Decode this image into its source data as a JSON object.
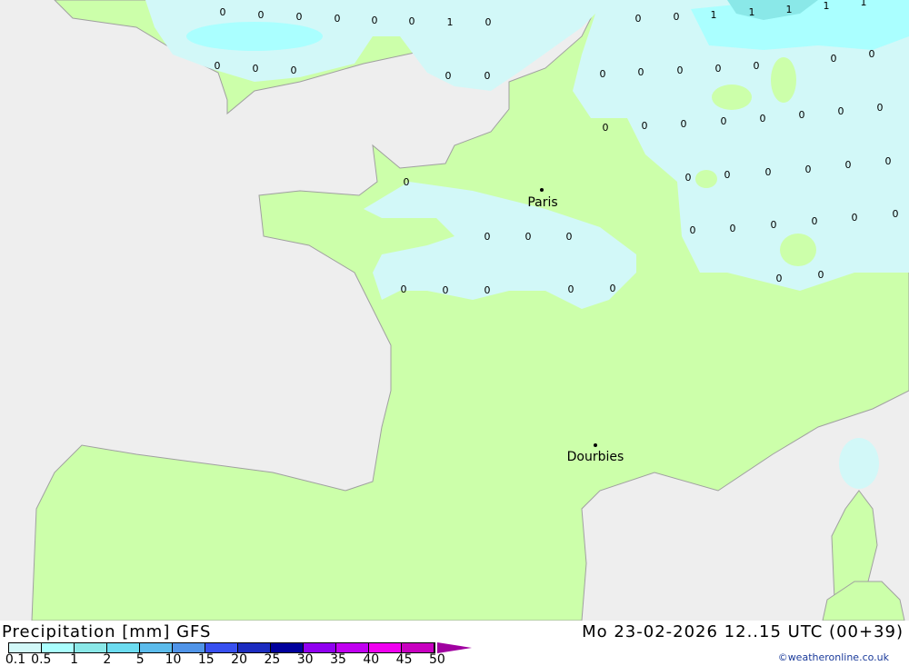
{
  "map": {
    "colors": {
      "sea": "#eeeeee",
      "land": "#ccffaa",
      "p01": "#d2f8f8",
      "p05": "#aaffff",
      "p1": "#8ae8e8",
      "border": "#a0a0a0"
    },
    "cities": [
      {
        "name": "Paris"
      },
      {
        "name": "Dourbies"
      }
    ],
    "values": [
      "0",
      "0",
      "0",
      "0",
      "0",
      "0",
      "1",
      "0",
      "0",
      "0",
      "0",
      "0",
      "0",
      "0",
      "0",
      "1",
      "1",
      "1",
      "1",
      "1",
      "0",
      "0",
      "0",
      "0",
      "0",
      "0",
      "0",
      "0",
      "0",
      "0",
      "0",
      "0",
      "0",
      "0",
      "0",
      "0",
      "0",
      "0",
      "0",
      "0",
      "0",
      "0",
      "0",
      "0",
      "0",
      "0",
      "0",
      "0",
      "0",
      "0",
      "0",
      "0",
      "0",
      "0",
      "0",
      "0",
      "0",
      "0"
    ]
  },
  "footer": {
    "title": "Precipitation [mm] GFS",
    "datetime": "Mo 23-02-2026 12..15 UTC (00+39)",
    "credit": "©weatheronline.co.uk",
    "scale": {
      "colors": [
        "#d2f8f8",
        "#aaffff",
        "#8ae8e8",
        "#6cdcf0",
        "#5cbcec",
        "#5094e8",
        "#3850f0",
        "#1c2cc0",
        "#00009c",
        "#9000f0",
        "#c000f0",
        "#f000f0",
        "#c800c0"
      ],
      "ticks": [
        "0.1",
        "0.5",
        "1",
        "2",
        "5",
        "10",
        "15",
        "20",
        "25",
        "30",
        "35",
        "40",
        "45",
        "50"
      ]
    }
  }
}
